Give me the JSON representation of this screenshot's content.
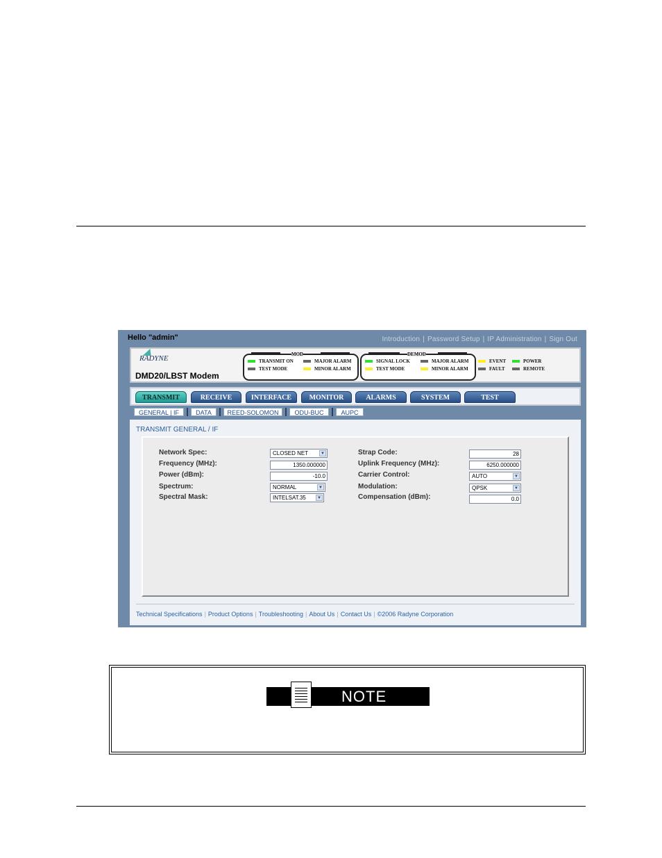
{
  "app": {
    "greeting": "Hello \"admin\"",
    "top_links": [
      "Introduction",
      "Password Setup",
      "IP Administration",
      "Sign Out"
    ],
    "brand": "RADYNE",
    "model": "DMD20/LBST Modem"
  },
  "status": {
    "mod": {
      "title": "MOD",
      "leds": [
        {
          "label": "TRANSMIT ON",
          "color": "#33dd33"
        },
        {
          "label": "MAJOR ALARM",
          "color": "#666666"
        },
        {
          "label": "TEST MODE",
          "color": "#666666"
        },
        {
          "label": "MINOR ALARM",
          "color": "#ffee22"
        }
      ]
    },
    "demod": {
      "title": "DEMOD",
      "leds": [
        {
          "label": "SIGNAL LOCK",
          "color": "#33dd33"
        },
        {
          "label": "MAJOR ALARM",
          "color": "#666666"
        },
        {
          "label": "TEST MODE",
          "color": "#ffee22"
        },
        {
          "label": "MINOR ALARM",
          "color": "#ffee22"
        }
      ]
    },
    "system": [
      {
        "label": "EVENT",
        "color": "#ffee22"
      },
      {
        "label": "POWER",
        "color": "#33dd33"
      },
      {
        "label": "FAULT",
        "color": "#666666"
      },
      {
        "label": "REMOTE",
        "color": "#666666"
      }
    ]
  },
  "tabs": [
    "TRANSMIT",
    "RECEIVE",
    "INTERFACE",
    "MONITOR",
    "ALARMS",
    "SYSTEM",
    "TEST"
  ],
  "active_tab": "TRANSMIT",
  "subtabs": [
    "GENERAL | IF",
    "DATA",
    "REED-SOLOMON",
    "ODU-BUC",
    "AUPC"
  ],
  "section_title": "TRANSMIT GENERAL / IF",
  "form": {
    "network_spec": {
      "label": "Network Spec:",
      "value": "CLOSED NET"
    },
    "frequency": {
      "label": "Frequency (MHz):",
      "value": "1350.000000"
    },
    "power": {
      "label": "Power (dBm):",
      "value": "-10.0"
    },
    "spectrum": {
      "label": "Spectrum:",
      "value": "NORMAL"
    },
    "spectral_mask": {
      "label": "Spectral Mask:",
      "value": "INTELSAT.35"
    },
    "strap_code": {
      "label": "Strap Code:",
      "value": "28"
    },
    "uplink_frequency": {
      "label": "Uplink Frequency (MHz):",
      "value": "6250.000000"
    },
    "carrier_control": {
      "label": "Carrier Control:",
      "value": "AUTO"
    },
    "modulation": {
      "label": "Modulation:",
      "value": "QPSK"
    },
    "compensation": {
      "label": "Compensation (dBm):",
      "value": "0.0"
    }
  },
  "footer_links": [
    "Technical Specifications",
    "Product Options",
    "Troubleshooting",
    "About Us",
    "Contact Us",
    "©2006 Radyne Corporation"
  ],
  "note": {
    "label": "NOTE"
  }
}
